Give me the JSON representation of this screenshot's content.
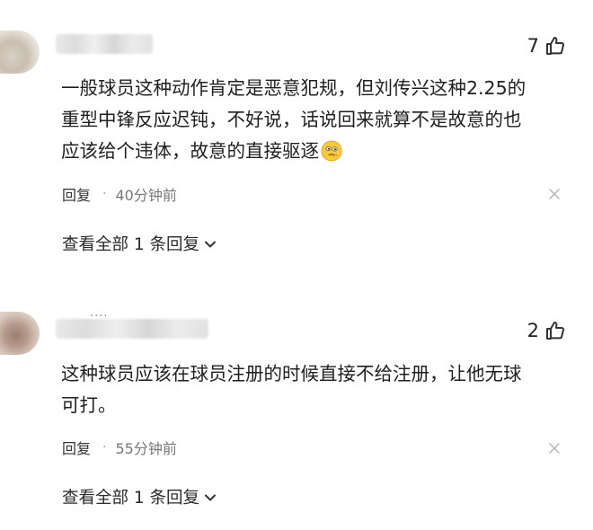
{
  "comments": [
    {
      "like_count": "7",
      "lines": [
        "一般球员这种动作肯定是恶意犯规，但刘传兴这种2.25的",
        "重型中锋反应迟钝，不好说，话说回来就算不是故意的也",
        "应该给个违体，故意的直接驱逐"
      ],
      "emoji": "thinking-face-icon",
      "reply_label": "回复",
      "separator": "·",
      "time": "40分钟前",
      "view_replies": "查看全部 1 条回复"
    },
    {
      "username_dots": "····",
      "like_count": "2",
      "lines": [
        "这种球员应该在球员注册的时候直接不给注册，让他无球",
        "可打。"
      ],
      "reply_label": "回复",
      "separator": "·",
      "time": "55分钟前",
      "view_replies": "查看全部 1 条回复"
    }
  ],
  "colors": {
    "text": "#1f1f1f",
    "meta": "#777777",
    "icon": "#333333"
  }
}
